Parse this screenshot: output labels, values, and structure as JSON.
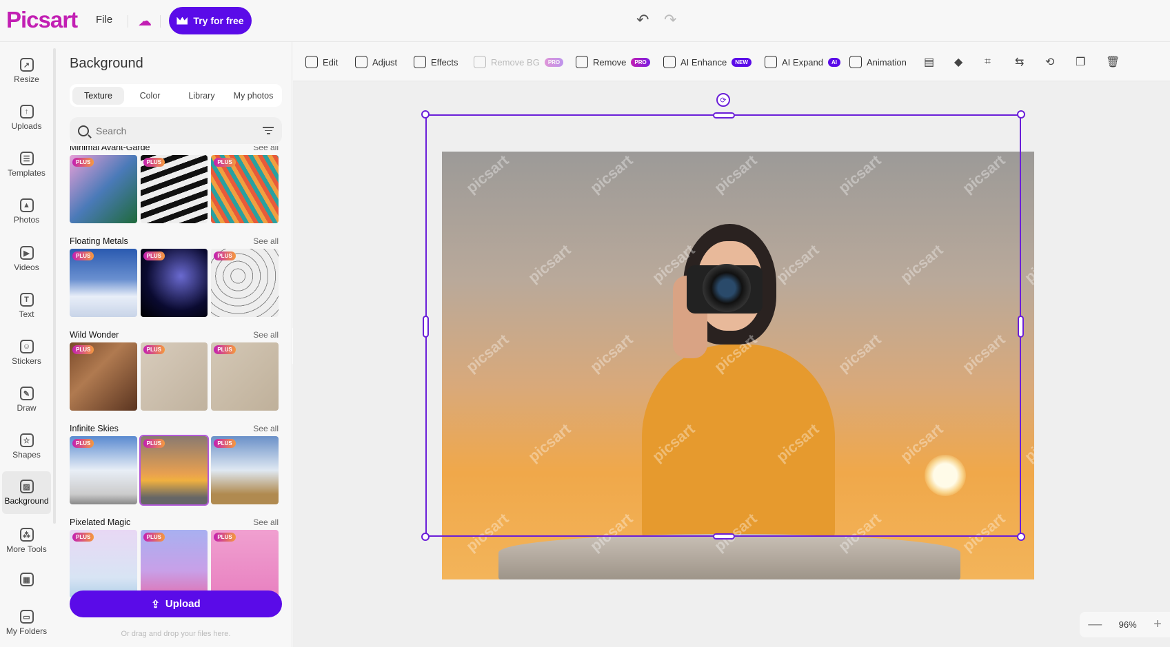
{
  "header": {
    "logo": "Picsart",
    "file": "File",
    "try_button": "Try for free",
    "undo": "↶",
    "redo": "↷"
  },
  "rail": {
    "items": [
      {
        "label": "Resize",
        "icon": "resize-icon",
        "glyph": "↗"
      },
      {
        "label": "Uploads",
        "icon": "upload-icon",
        "glyph": "↑"
      },
      {
        "label": "Templates",
        "icon": "templates-icon",
        "glyph": "☰"
      },
      {
        "label": "Photos",
        "icon": "photo-icon",
        "glyph": "▲"
      },
      {
        "label": "Videos",
        "icon": "video-icon",
        "glyph": "▶"
      },
      {
        "label": "Text",
        "icon": "text-icon",
        "glyph": "T"
      },
      {
        "label": "Stickers",
        "icon": "sticker-icon",
        "glyph": "☺"
      },
      {
        "label": "Draw",
        "icon": "brush-icon",
        "glyph": "✎"
      },
      {
        "label": "Shapes",
        "icon": "star-icon",
        "glyph": "☆"
      },
      {
        "label": "Background",
        "icon": "background-icon",
        "glyph": "▨"
      },
      {
        "label": "More Tools",
        "icon": "more-tools-icon",
        "glyph": "⁂"
      },
      {
        "label": "",
        "icon": "apps-grid-icon",
        "glyph": "▦"
      },
      {
        "label": "My Folders",
        "icon": "folder-icon",
        "glyph": "▭"
      }
    ],
    "active": "Background"
  },
  "panel": {
    "title": "Background",
    "tabs": [
      "Texture",
      "Color",
      "Library",
      "My photos"
    ],
    "active_tab": "Texture",
    "search_placeholder": "Search",
    "see_all": "See all",
    "plus_badge": "PLUS",
    "sections": [
      {
        "title": "Minimal Avant-Garde"
      },
      {
        "title": "Floating Metals"
      },
      {
        "title": "Wild Wonder"
      },
      {
        "title": "Infinite Skies"
      },
      {
        "title": "Pixelated Magic"
      }
    ],
    "upload_button": "Upload",
    "drag_hint": "Or drag and drop your files here."
  },
  "toolbar": {
    "items": [
      {
        "label": "Edit",
        "icon": "edit-icon"
      },
      {
        "label": "Adjust",
        "icon": "adjust-icon"
      },
      {
        "label": "Effects",
        "icon": "fx-icon"
      },
      {
        "label": "Remove BG",
        "icon": "remove-bg-icon",
        "badge": "PRO",
        "disabled": true
      },
      {
        "label": "Remove",
        "icon": "eraser-wand-icon",
        "badge": "PRO"
      },
      {
        "label": "AI Enhance",
        "icon": "ai-enhance-icon",
        "badge": "NEW"
      },
      {
        "label": "AI Expand",
        "icon": "expand-icon",
        "badge": "AI"
      },
      {
        "label": "Animation",
        "icon": "animation-icon"
      }
    ],
    "icon_buttons": [
      "align-icon",
      "eraser-icon",
      "crop-icon",
      "replace-icon",
      "flip-icon",
      "duplicate-icon",
      "trash-icon"
    ]
  },
  "canvas": {
    "watermark": "picsart",
    "zoom": "96%",
    "zoom_out": "—",
    "zoom_in": "+"
  },
  "colors": {
    "brand": "#c21fb3",
    "primary": "#5a0be8",
    "selection": "#6a1ed8"
  }
}
